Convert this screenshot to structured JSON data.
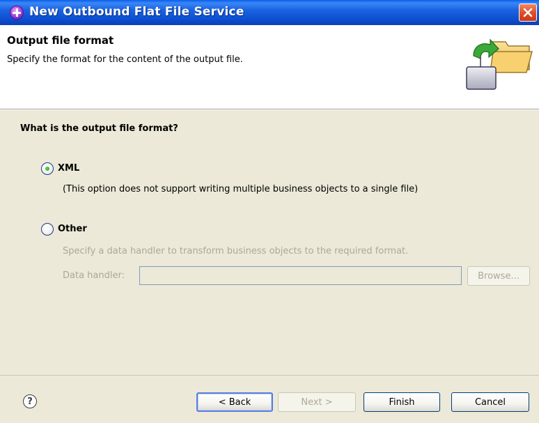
{
  "window": {
    "title": "New Outbound Flat File Service",
    "app_icon": "eclipse-wizard-icon",
    "close_icon": "close-icon"
  },
  "header": {
    "title": "Output file format",
    "description": "Specify the format for the content of the output file.",
    "banner_icon": "folder-export-icon"
  },
  "body": {
    "question": "What is the output file format?",
    "options": [
      {
        "label": "XML",
        "selected": true,
        "description": "(This option does not support writing multiple business objects to a single file)"
      },
      {
        "label": "Other",
        "selected": false,
        "description": "Specify a data handler to transform business objects to the required format."
      }
    ],
    "data_handler": {
      "label": "Data handler:",
      "value": "",
      "browse_label": "Browse..."
    }
  },
  "footer": {
    "help_icon": "help-icon",
    "back_label": "< Back",
    "next_label": "Next >",
    "finish_label": "Finish",
    "cancel_label": "Cancel"
  },
  "colors": {
    "titlebar": "#0e4fd0",
    "dialog_bg": "#ece9d8",
    "disabled_text": "#aca899",
    "radio_dot": "#21a121"
  }
}
